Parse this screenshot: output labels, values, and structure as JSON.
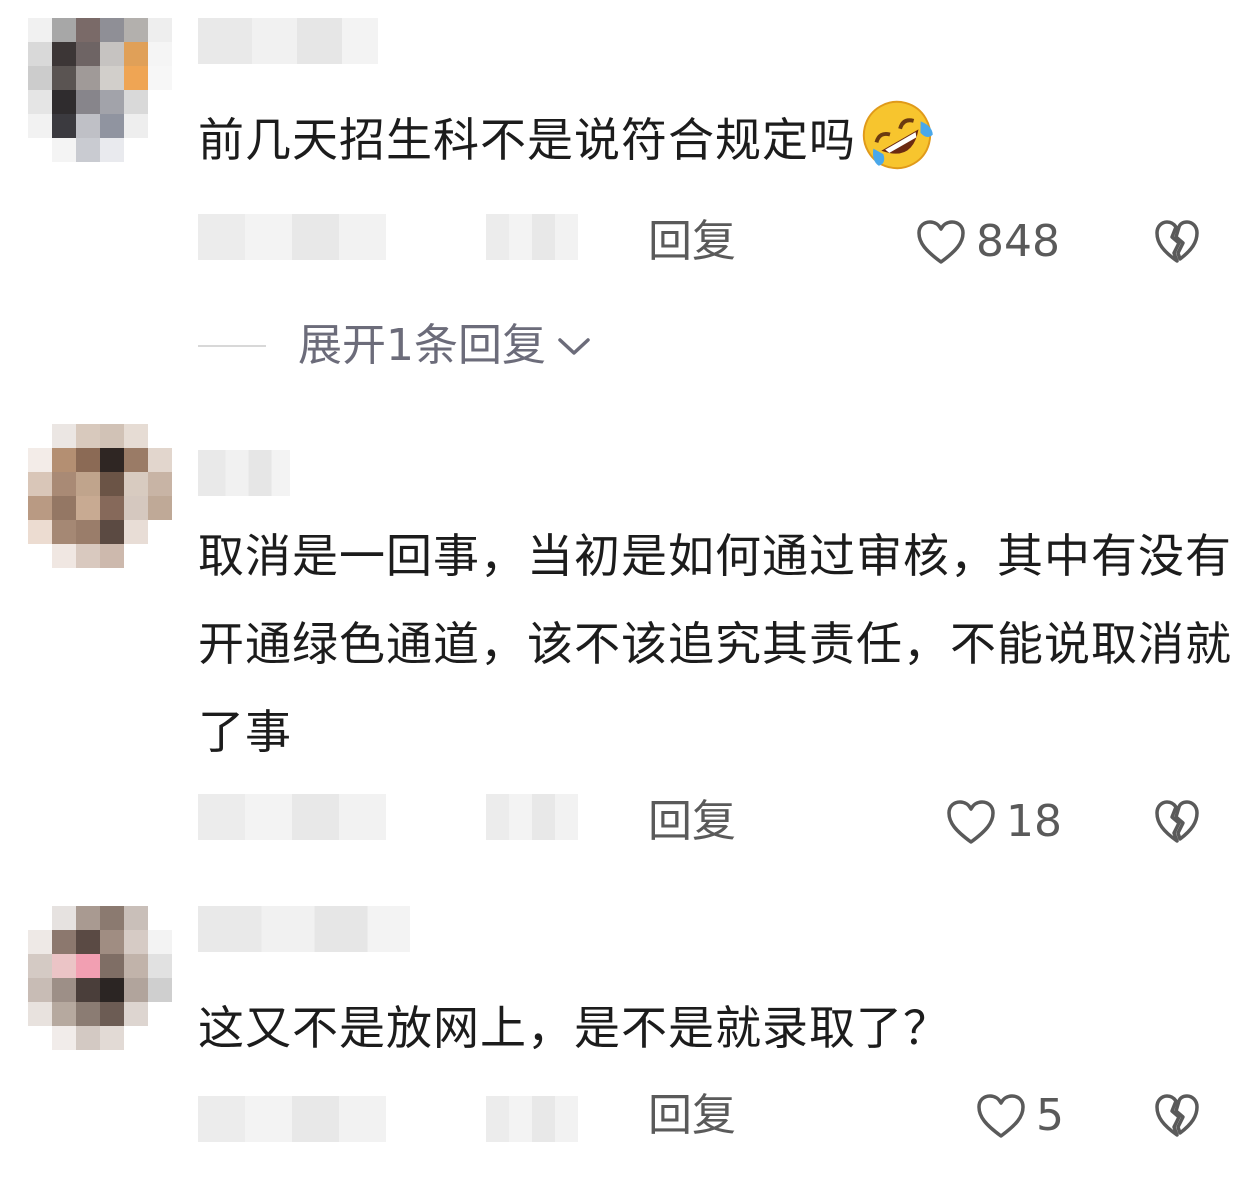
{
  "comments": [
    {
      "text": "前几天招生科不是说符合规定吗",
      "emoji": "rolling-on-floor-laughing-emoji",
      "reply_label": "回复",
      "likes": "848",
      "expand_label": "展开1条回复"
    },
    {
      "text": "取消是一回事，当初是如何通过审核，其中有没有开通绿色通道，该不该追究其责任，不能说取消就了事",
      "reply_label": "回复",
      "likes": "18"
    },
    {
      "text": "这又不是放网上，是不是就录取了？",
      "reply_label": "回复",
      "likes": "5"
    }
  ],
  "colors": {
    "text": "#1c1c1c",
    "meta": "#5a5a5a",
    "expand": "#6c6c7a",
    "emoji_face": "#f7c52e"
  },
  "icons": [
    "heart-outline-icon",
    "broken-heart-icon",
    "chevron-down-icon"
  ]
}
